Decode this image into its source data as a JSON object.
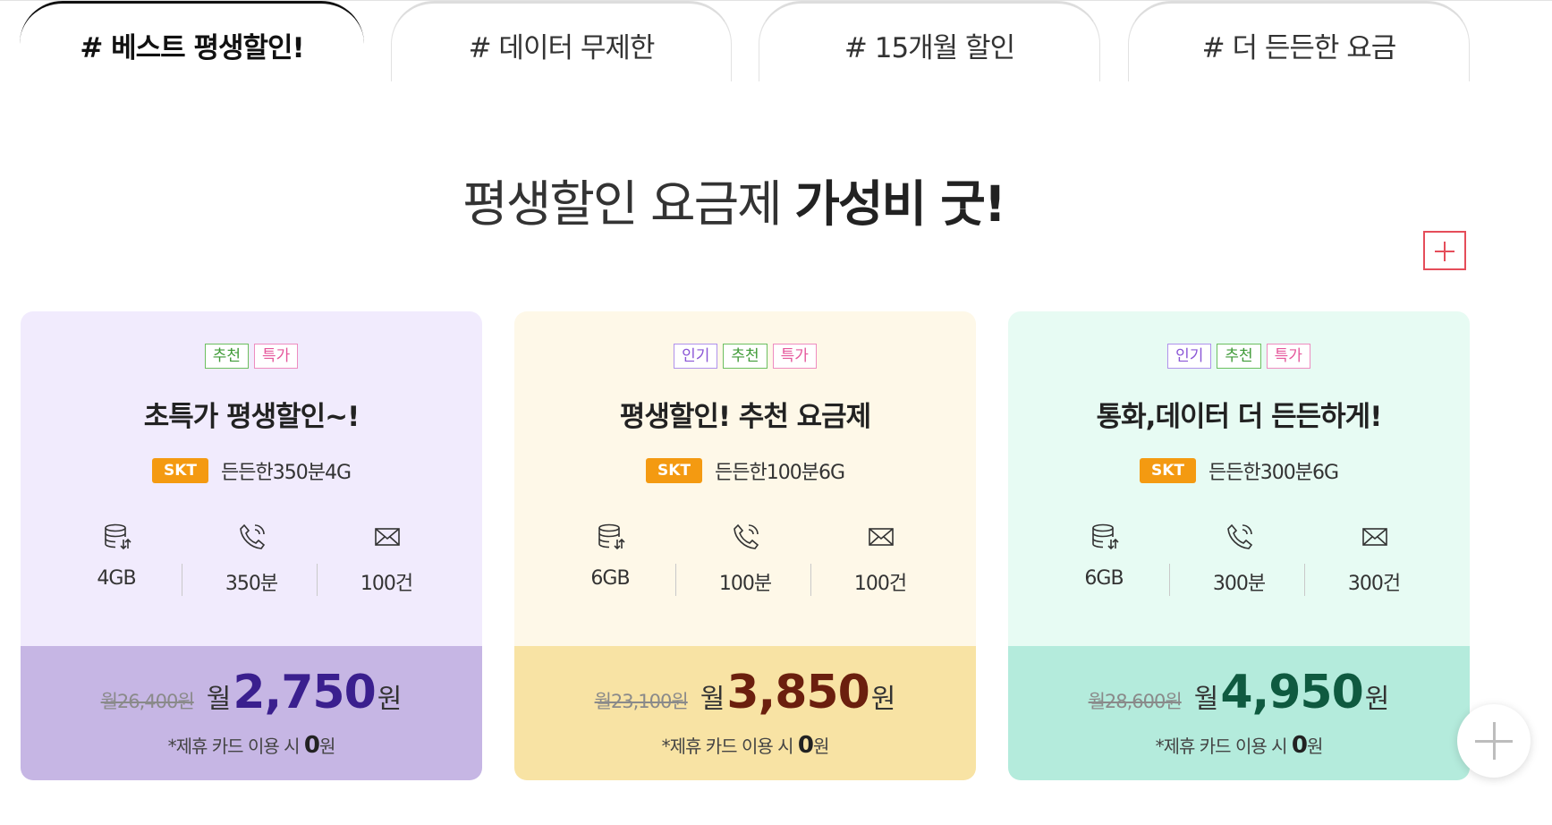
{
  "tabs": [
    {
      "label": "# 베스트 평생할인!",
      "active": true
    },
    {
      "label": "# 데이터 무제한",
      "active": false
    },
    {
      "label": "# 15개월 할인",
      "active": false
    },
    {
      "label": "# 더 든든한 요금",
      "active": false
    }
  ],
  "headline": {
    "normal": "평생할인 요금제 ",
    "strong": "가성비 굿!"
  },
  "colors": {
    "accent_plus": "#e54d5a",
    "carrier_badge": "#f49a11"
  },
  "cards": [
    {
      "badges": [
        "추천",
        "특가"
      ],
      "title": "초특가 평생할인~!",
      "carrier": "SKT",
      "plan_name": "든든한350분4G",
      "specs": {
        "data": "4GB",
        "call": "350분",
        "sms": "100건"
      },
      "original_price": "월26,400원",
      "price_prefix": "월",
      "price_amount": "2,750",
      "price_suffix": "원",
      "note_text": "*제휴 카드 이용 시 ",
      "note_zero": "0",
      "note_unit": "원"
    },
    {
      "badges": [
        "인기",
        "추천",
        "특가"
      ],
      "title": "평생할인! 추천 요금제",
      "carrier": "SKT",
      "plan_name": "든든한100분6G",
      "specs": {
        "data": "6GB",
        "call": "100분",
        "sms": "100건"
      },
      "original_price": "월23,100원",
      "price_prefix": "월",
      "price_amount": "3,850",
      "price_suffix": "원",
      "note_text": "*제휴 카드 이용 시 ",
      "note_zero": "0",
      "note_unit": "원"
    },
    {
      "badges": [
        "인기",
        "추천",
        "특가"
      ],
      "title": "통화,데이터 더 든든하게!",
      "carrier": "SKT",
      "plan_name": "든든한300분6G",
      "specs": {
        "data": "6GB",
        "call": "300분",
        "sms": "300건"
      },
      "original_price": "월28,600원",
      "price_prefix": "월",
      "price_amount": "4,950",
      "price_suffix": "원",
      "note_text": "*제휴 카드 이용 시 ",
      "note_zero": "0",
      "note_unit": "원"
    }
  ],
  "icons": {
    "data": "database-icon",
    "call": "phone-icon",
    "sms": "envelope-icon",
    "expand": "plus-icon"
  }
}
